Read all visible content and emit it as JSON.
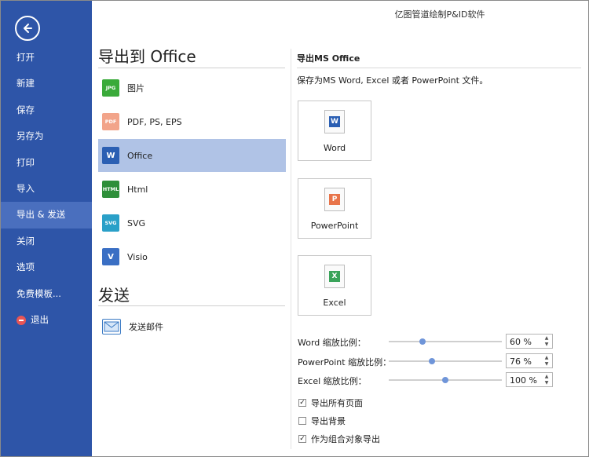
{
  "app_title": "亿图管道绘制P&ID软件",
  "sidebar": {
    "items": [
      {
        "label": "打开",
        "active": false
      },
      {
        "label": "新建",
        "active": false
      },
      {
        "label": "保存",
        "active": false
      },
      {
        "label": "另存为",
        "active": false
      },
      {
        "label": "打印",
        "active": false
      },
      {
        "label": "导入",
        "active": false
      },
      {
        "label": "导出 & 发送",
        "active": true
      },
      {
        "label": "关闭",
        "active": false
      },
      {
        "label": "选项",
        "active": false
      },
      {
        "label": "免费模板...",
        "active": false
      },
      {
        "label": "退出",
        "active": false,
        "icon": "exit-icon"
      }
    ]
  },
  "export": {
    "heading": "导出到 Office",
    "options": [
      {
        "label": "图片",
        "icon": "jpg-icon",
        "icon_text": "JPG",
        "color": "#3aaa3a",
        "selected": false
      },
      {
        "label": "PDF, PS, EPS",
        "icon": "pdf-icon",
        "icon_text": "PDF",
        "color": "#f2a48a",
        "selected": false
      },
      {
        "label": "Office",
        "icon": "word-icon",
        "icon_text": "W",
        "color": "#2b5fb3",
        "selected": true
      },
      {
        "label": "Html",
        "icon": "html-icon",
        "icon_text": "HTML",
        "color": "#2f8f3a",
        "selected": false
      },
      {
        "label": "SVG",
        "icon": "svg-icon",
        "icon_text": "SVG",
        "color": "#2aa0c8",
        "selected": false
      },
      {
        "label": "Visio",
        "icon": "visio-icon",
        "icon_text": "V",
        "color": "#3a6fc4",
        "selected": false
      }
    ]
  },
  "send": {
    "heading": "发送",
    "options": [
      {
        "label": "发送邮件",
        "icon": "email-icon"
      }
    ]
  },
  "ms_office": {
    "title": "导出MS Office",
    "description": "保存为MS Word, Excel 或者 PowerPoint 文件。",
    "buttons": [
      {
        "label": "Word",
        "icon": "word-doc-icon",
        "letter": "W",
        "color": "#2b5fb3"
      },
      {
        "label": "PowerPoint",
        "icon": "powerpoint-doc-icon",
        "letter": "P",
        "color": "#e8744a"
      },
      {
        "label": "Excel",
        "icon": "excel-doc-icon",
        "letter": "X",
        "color": "#3aa35a"
      }
    ],
    "zoom": [
      {
        "label": "Word 缩放比例：",
        "value": "60 %",
        "level": 0.3
      },
      {
        "label": "PowerPoint 缩放比例：",
        "value": "76 %",
        "level": 0.38
      },
      {
        "label": "Excel 缩放比例：",
        "value": "100 %",
        "level": 0.5
      }
    ],
    "checkboxes": [
      {
        "label": "导出所有页面",
        "checked": true
      },
      {
        "label": "导出背景",
        "checked": false
      },
      {
        "label": "作为组合对象导出",
        "checked": true
      }
    ]
  }
}
